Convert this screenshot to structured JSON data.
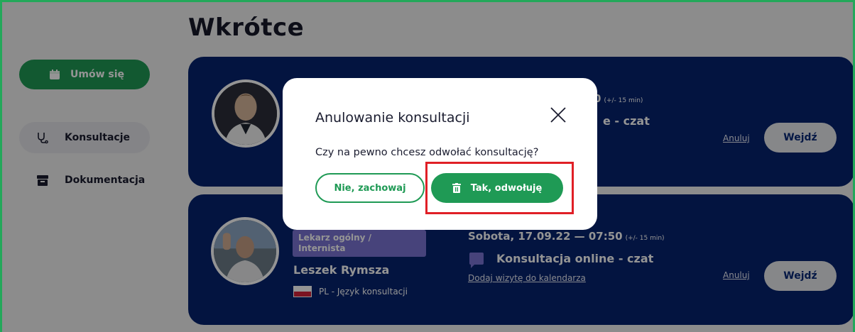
{
  "page": {
    "title": "Wkrótce"
  },
  "sidebar": {
    "book_button": {
      "label": "Umów się",
      "icon": "calendar-icon"
    },
    "items": [
      {
        "label": "Konsultacje",
        "icon": "stethoscope-icon",
        "active": true
      },
      {
        "label": "Dokumentacja",
        "icon": "archive-box-icon",
        "active": false
      }
    ]
  },
  "appointments": [
    {
      "date": "0",
      "tolerance": "(+/- 15 min)",
      "type": "e - czat",
      "cancel_label": "Anuluj",
      "enter_label": "Wejdź"
    },
    {
      "specialty": "Lekarz ogólny / Internista",
      "doctor": "Leszek Rymsza",
      "language": "PL - Język konsultacji",
      "date": "Sobota, 17.09.22 — 07:50",
      "tolerance": "(+/- 15 min)",
      "type": "Konsultacja online - czat",
      "calendar_link": "Dodaj wizytę do kalendarza",
      "cancel_label": "Anuluj",
      "enter_label": "Wejdź"
    }
  ],
  "modal": {
    "title": "Anulowanie konsultacji",
    "question": "Czy na pewno chcesz odwołać konsultację?",
    "keep_label": "Nie, zachowaj",
    "confirm_label": "Tak, odwołuję"
  },
  "colors": {
    "accent_green": "#1f9a55",
    "card_navy": "#06236e",
    "badge_purple": "#7b74d4",
    "highlight_red": "#e01f26"
  }
}
